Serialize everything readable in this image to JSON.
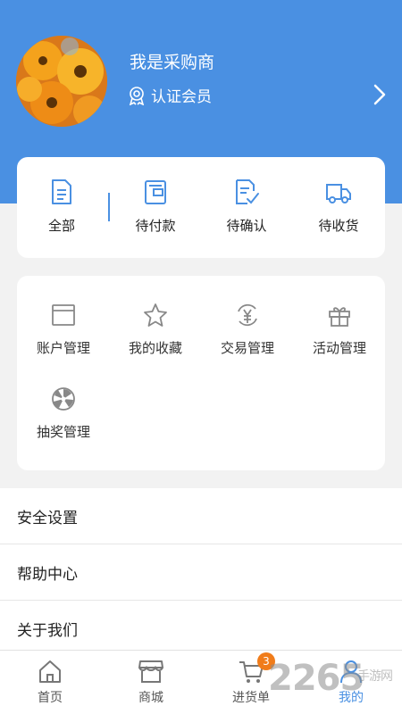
{
  "profile": {
    "name": "我是采购商",
    "badge_label": "认证会员"
  },
  "orders": [
    {
      "label": "全部",
      "icon": "document-icon"
    },
    {
      "label": "待付款",
      "icon": "wallet-icon"
    },
    {
      "label": "待确认",
      "icon": "confirm-doc-icon"
    },
    {
      "label": "待收货",
      "icon": "truck-icon"
    }
  ],
  "tools": [
    {
      "label": "账户管理",
      "icon": "account-card-icon"
    },
    {
      "label": "我的收藏",
      "icon": "star-icon"
    },
    {
      "label": "交易管理",
      "icon": "yen-exchange-icon"
    },
    {
      "label": "活动管理",
      "icon": "gift-icon"
    },
    {
      "label": "抽奖管理",
      "icon": "lottery-wheel-icon"
    }
  ],
  "settings": [
    {
      "label": "安全设置"
    },
    {
      "label": "帮助中心"
    },
    {
      "label": "关于我们"
    }
  ],
  "tabbar": {
    "items": [
      {
        "label": "首页",
        "icon": "home-icon"
      },
      {
        "label": "商城",
        "icon": "shop-icon"
      },
      {
        "label": "进货单",
        "icon": "cart-icon",
        "badge": "3"
      },
      {
        "label": "我的",
        "icon": "user-icon",
        "active": true
      }
    ]
  },
  "watermark": {
    "big": "2265",
    "small": "手游网"
  },
  "colors": {
    "accent": "#4a90e2",
    "badge": "#f07c1a",
    "background": "#f2f2f2"
  }
}
